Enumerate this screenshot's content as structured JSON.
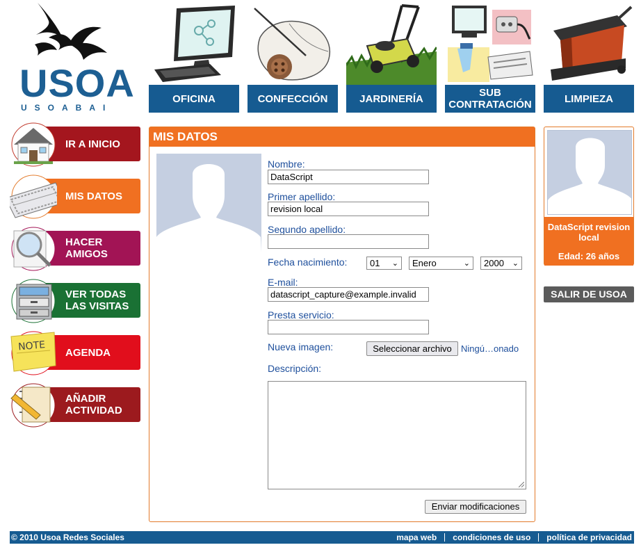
{
  "logo": {
    "text": "USOA",
    "subtext": "USOABAI"
  },
  "categories": [
    {
      "label": "OFICINA",
      "icon": "monitor-icon"
    },
    {
      "label": "CONFECCIÓN",
      "icon": "sewing-icon"
    },
    {
      "label": "JARDINERÍA",
      "icon": "lawnmower-icon"
    },
    {
      "label": "SUB CONTRATACIÓN",
      "icon": "subcontract-icon"
    },
    {
      "label": "LIMPIEZA",
      "icon": "floor-cleaner-icon"
    }
  ],
  "menu": [
    {
      "label": "IR A INICIO",
      "color": "#a4161e",
      "icon": "house-icon"
    },
    {
      "label": "MIS DATOS",
      "color": "#f07021",
      "icon": "keyboard-icon"
    },
    {
      "label": "HACER AMIGOS",
      "color": "#a21455",
      "icon": "magnifier-icon"
    },
    {
      "label": "VER TODAS LAS VISITAS",
      "color": "#1a7134",
      "icon": "cabinet-icon"
    },
    {
      "label": "AGENDA",
      "color": "#e10e1c",
      "icon": "note-icon"
    },
    {
      "label": "AÑADIR ACTIVIDAD",
      "color": "#9c1a1e",
      "icon": "notebook-pencil-icon"
    }
  ],
  "panel": {
    "title": "MIS DATOS",
    "fields": {
      "nombre": {
        "label": "Nombre:",
        "value": "DataScript"
      },
      "apellido1": {
        "label": "Primer apellido:",
        "value": "revision local"
      },
      "apellido2": {
        "label": "Segundo apellido:",
        "value": ""
      },
      "nacimiento": {
        "label": "Fecha nacimiento:",
        "day": "01",
        "month": "Enero",
        "year": "2000"
      },
      "email": {
        "label": "E-mail:",
        "value": "datascript_capture@example.invalid"
      },
      "servicio": {
        "label": "Presta servicio:",
        "value": ""
      },
      "imagen": {
        "label": "Nueva imagen:",
        "button": "Seleccionar archivo",
        "status": "Ningú…onado"
      },
      "descripcion": {
        "label": "Descripción:",
        "value": ""
      }
    },
    "submit": "Enviar modificaciones"
  },
  "profile": {
    "name": "DataScript revision local",
    "age": "Edad: 26 años"
  },
  "logout": "SALIR DE USOA",
  "footer": {
    "copyright": "© 2010 Usoa Redes Sociales",
    "links": [
      "mapa web",
      "condiciones de uso",
      "política de privacidad"
    ]
  },
  "colors": {
    "brand_blue": "#165b91",
    "accent_orange": "#f07021",
    "logout_gray": "#5b5b5b",
    "label_blue": "#1e4f9c"
  }
}
